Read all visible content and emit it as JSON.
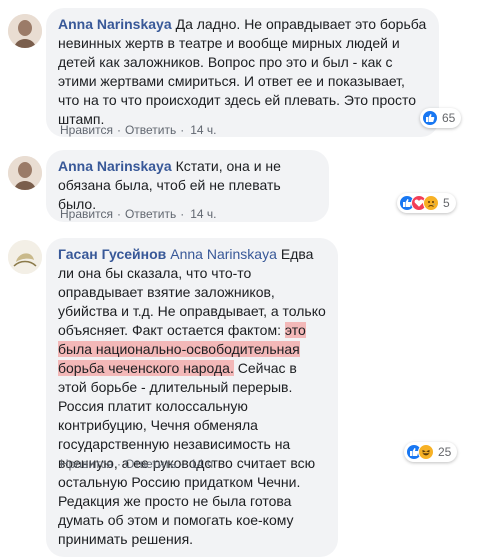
{
  "comments": [
    {
      "author": "Anna Narinskaya",
      "text": "Да ладно. Не оправдывает это борьба невинных жертв в театре и вообще мирных людей и детей как заложников. Вопрос про это и был - как с этими жертвами смириться. И ответ ее и показывает, что на то что происходит здесь ей плевать. Это просто штамп.",
      "like_label": "Нравится",
      "reply_label": "Ответить",
      "time": "14 ч.",
      "reactions_count": "65",
      "reaction_icons": [
        "like-icon"
      ]
    },
    {
      "author": "Anna Narinskaya",
      "text": "Кстати, она и не обязана была, чтоб ей не плевать было.",
      "like_label": "Нравится",
      "reply_label": "Ответить",
      "time": "14 ч.",
      "reactions_count": "5",
      "reaction_icons": [
        "like-icon",
        "love-icon",
        "sad-icon"
      ]
    },
    {
      "author": "Гасан Гусейнов",
      "mention": "Anna Narinskaya",
      "text_before": "Едва ли она бы сказала, что что-то оправдывает взятие заложников, убийства и т.д. Не оправдывает, а только объясняет. Факт остается фактом:",
      "text_highlight": "это была национально-освободительная борьба чеченского народа.",
      "text_after": "Сейчас в этой борьбе - длительный перерыв. Россия платит колоссальную контрибуцию, Чечня обменяла государственную независимость на военную, а ее руководство считает всю остальную Россию придатком Чечни.",
      "text_para2": "Редакция же просто не была готова думать об этом и помогать кое-кому принимать решения.",
      "like_label": "Нравится",
      "reply_label": "Ответить",
      "time": "14 ч.",
      "reactions_count": "25",
      "reaction_icons": [
        "like-icon",
        "haha-icon"
      ]
    }
  ],
  "colors": {
    "author": "#385898",
    "bubble": "#f2f3f5",
    "highlight": "#f3b8b8",
    "like": "#1877f2"
  }
}
